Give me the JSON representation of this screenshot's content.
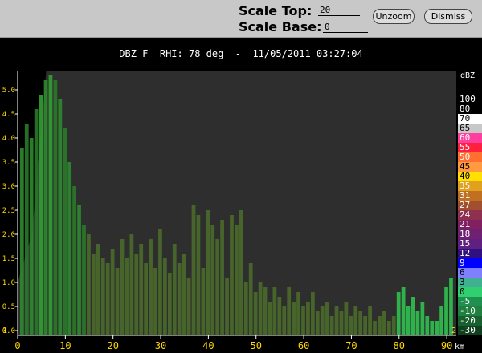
{
  "controls": {
    "scale_top_label": "Scale Top:",
    "scale_top_value": "20",
    "scale_base_label": "Scale Base:",
    "scale_base_value": "0",
    "unzoom_label": "Unzoom",
    "dismiss_label": "Dismiss"
  },
  "display": {
    "title": "DBZ F  RHI: 78 deg  -  11/05/2011 03:27:04",
    "colorbar_unit": "dBZ",
    "x_unit": "km",
    "range_mark_left": "1",
    "range_mark_right": "2"
  },
  "colorbar": {
    "entries": [
      {
        "label": "100",
        "color": "#000000"
      },
      {
        "label": "80",
        "color": "#000000"
      },
      {
        "label": "70",
        "color": "#ffffff"
      },
      {
        "label": "65",
        "color": "#c8c8c8"
      },
      {
        "label": "60",
        "color": "#ff40a0"
      },
      {
        "label": "55",
        "color": "#ff2040"
      },
      {
        "label": "50",
        "color": "#ff7030"
      },
      {
        "label": "45",
        "color": "#ff9a40"
      },
      {
        "label": "40",
        "color": "#ffe000"
      },
      {
        "label": "35",
        "color": "#e0a020"
      },
      {
        "label": "31",
        "color": "#c07020"
      },
      {
        "label": "27",
        "color": "#a05030"
      },
      {
        "label": "24",
        "color": "#903050"
      },
      {
        "label": "21",
        "color": "#802060"
      },
      {
        "label": "18",
        "color": "#702070"
      },
      {
        "label": "15",
        "color": "#602080"
      },
      {
        "label": "12",
        "color": "#301080"
      },
      {
        "label": "9",
        "color": "#0000ff"
      },
      {
        "label": "6",
        "color": "#8080ff"
      },
      {
        "label": "3",
        "color": "#40b090"
      },
      {
        "label": "0",
        "color": "#30d070"
      },
      {
        "label": "-5",
        "color": "#209050"
      },
      {
        "label": "-10",
        "color": "#208040"
      },
      {
        "label": "-20",
        "color": "#186030"
      },
      {
        "label": "-30",
        "color": "#104020"
      }
    ]
  },
  "chart_data": {
    "type": "heatmap",
    "title": "DBZ F  RHI: 78 deg  -  11/05/2011 03:27:04",
    "xlabel": "km",
    "ylabel": "",
    "x_ticks": [
      0,
      10,
      20,
      30,
      40,
      50,
      60,
      70,
      80,
      90
    ],
    "y_ticks": [
      0.0,
      0.5,
      1.0,
      1.5,
      2.0,
      2.5,
      3.0,
      3.5,
      4.0,
      4.5,
      5.0
    ],
    "xlim": [
      0,
      92
    ],
    "ylim": [
      -0.1,
      5.4
    ],
    "columns": [
      {
        "x": 1,
        "top": 3.8,
        "c": "#2d8a2d"
      },
      {
        "x": 2,
        "top": 4.3,
        "c": "#2a7a2a"
      },
      {
        "x": 3,
        "top": 4.0,
        "c": "#2d8a2d"
      },
      {
        "x": 4,
        "top": 4.6,
        "c": "#2a7a2a"
      },
      {
        "x": 5,
        "top": 4.9,
        "c": "#33a033"
      },
      {
        "x": 6,
        "top": 5.2,
        "c": "#2d8a2d"
      },
      {
        "x": 7,
        "top": 5.3,
        "c": "#33a033"
      },
      {
        "x": 8,
        "top": 5.2,
        "c": "#2a7a2a"
      },
      {
        "x": 9,
        "top": 4.8,
        "c": "#2d8a2d"
      },
      {
        "x": 10,
        "top": 4.2,
        "c": "#2a7a2a"
      },
      {
        "x": 11,
        "top": 3.5,
        "c": "#2d8a2d"
      },
      {
        "x": 12,
        "top": 3.0,
        "c": "#2a7a2a"
      },
      {
        "x": 13,
        "top": 2.6,
        "c": "#2d8a2d"
      },
      {
        "x": 14,
        "top": 2.2,
        "c": "#2a7a2a"
      },
      {
        "x": 15,
        "top": 2.0,
        "c": "#4a6a2a"
      },
      {
        "x": 16,
        "top": 1.6,
        "c": "#4a6a2a"
      },
      {
        "x": 17,
        "top": 1.8,
        "c": "#4a6a2a"
      },
      {
        "x": 18,
        "top": 1.5,
        "c": "#4a6a2a"
      },
      {
        "x": 19,
        "top": 1.4,
        "c": "#4a6a2a"
      },
      {
        "x": 20,
        "top": 1.7,
        "c": "#4a6a2a"
      },
      {
        "x": 21,
        "top": 1.3,
        "c": "#4a6a2a"
      },
      {
        "x": 22,
        "top": 1.9,
        "c": "#4a6a2a"
      },
      {
        "x": 23,
        "top": 1.5,
        "c": "#4a6a2a"
      },
      {
        "x": 24,
        "top": 2.0,
        "c": "#4a6a2a"
      },
      {
        "x": 25,
        "top": 1.6,
        "c": "#4a6a2a"
      },
      {
        "x": 26,
        "top": 1.8,
        "c": "#4a6a2a"
      },
      {
        "x": 27,
        "top": 1.4,
        "c": "#4a6a2a"
      },
      {
        "x": 28,
        "top": 1.9,
        "c": "#4a6a2a"
      },
      {
        "x": 29,
        "top": 1.3,
        "c": "#4a6a2a"
      },
      {
        "x": 30,
        "top": 2.1,
        "c": "#4a6a2a"
      },
      {
        "x": 31,
        "top": 1.5,
        "c": "#4a6a2a"
      },
      {
        "x": 32,
        "top": 1.2,
        "c": "#4a6a2a"
      },
      {
        "x": 33,
        "top": 1.8,
        "c": "#4a6a2a"
      },
      {
        "x": 34,
        "top": 1.4,
        "c": "#4a6a2a"
      },
      {
        "x": 35,
        "top": 1.6,
        "c": "#4a6a2a"
      },
      {
        "x": 36,
        "top": 1.1,
        "c": "#4a6a2a"
      },
      {
        "x": 37,
        "top": 2.6,
        "c": "#4a6a2a"
      },
      {
        "x": 38,
        "top": 2.4,
        "c": "#4a6a2a"
      },
      {
        "x": 39,
        "top": 1.3,
        "c": "#4a6a2a"
      },
      {
        "x": 40,
        "top": 2.5,
        "c": "#4a6a2a"
      },
      {
        "x": 41,
        "top": 2.2,
        "c": "#4a6a2a"
      },
      {
        "x": 42,
        "top": 1.9,
        "c": "#4a6a2a"
      },
      {
        "x": 43,
        "top": 2.3,
        "c": "#4a6a2a"
      },
      {
        "x": 44,
        "top": 1.1,
        "c": "#4a6a2a"
      },
      {
        "x": 45,
        "top": 2.4,
        "c": "#4a6a2a"
      },
      {
        "x": 46,
        "top": 2.2,
        "c": "#4a6a2a"
      },
      {
        "x": 47,
        "top": 2.5,
        "c": "#4a6a2a"
      },
      {
        "x": 48,
        "top": 1.0,
        "c": "#4a6a2a"
      },
      {
        "x": 49,
        "top": 1.4,
        "c": "#4a6a2a"
      },
      {
        "x": 50,
        "top": 0.8,
        "c": "#4a6a2a"
      },
      {
        "x": 51,
        "top": 1.0,
        "c": "#4a6a2a"
      },
      {
        "x": 52,
        "top": 0.9,
        "c": "#4a6a2a"
      },
      {
        "x": 53,
        "top": 0.6,
        "c": "#4a6a2a"
      },
      {
        "x": 54,
        "top": 0.9,
        "c": "#4a6a2a"
      },
      {
        "x": 55,
        "top": 0.7,
        "c": "#4a6a2a"
      },
      {
        "x": 56,
        "top": 0.5,
        "c": "#4a6a2a"
      },
      {
        "x": 57,
        "top": 0.9,
        "c": "#4a6a2a"
      },
      {
        "x": 58,
        "top": 0.6,
        "c": "#4a6a2a"
      },
      {
        "x": 59,
        "top": 0.8,
        "c": "#4a6a2a"
      },
      {
        "x": 60,
        "top": 0.5,
        "c": "#4a6a2a"
      },
      {
        "x": 61,
        "top": 0.6,
        "c": "#4a6a2a"
      },
      {
        "x": 62,
        "top": 0.8,
        "c": "#4a6a2a"
      },
      {
        "x": 63,
        "top": 0.4,
        "c": "#4a6a2a"
      },
      {
        "x": 64,
        "top": 0.5,
        "c": "#4a6a2a"
      },
      {
        "x": 65,
        "top": 0.6,
        "c": "#4a6a2a"
      },
      {
        "x": 66,
        "top": 0.3,
        "c": "#4a6a2a"
      },
      {
        "x": 67,
        "top": 0.5,
        "c": "#4a6a2a"
      },
      {
        "x": 68,
        "top": 0.4,
        "c": "#4a6a2a"
      },
      {
        "x": 69,
        "top": 0.6,
        "c": "#4a6a2a"
      },
      {
        "x": 70,
        "top": 0.3,
        "c": "#4a6a2a"
      },
      {
        "x": 71,
        "top": 0.5,
        "c": "#4a6a2a"
      },
      {
        "x": 72,
        "top": 0.4,
        "c": "#4a6a2a"
      },
      {
        "x": 73,
        "top": 0.3,
        "c": "#4a6a2a"
      },
      {
        "x": 74,
        "top": 0.5,
        "c": "#4a6a2a"
      },
      {
        "x": 75,
        "top": 0.2,
        "c": "#4a6a2a"
      },
      {
        "x": 76,
        "top": 0.3,
        "c": "#4a6a2a"
      },
      {
        "x": 77,
        "top": 0.4,
        "c": "#4a6a2a"
      },
      {
        "x": 78,
        "top": 0.2,
        "c": "#4a6a2a"
      },
      {
        "x": 79,
        "top": 0.3,
        "c": "#4a6a2a"
      },
      {
        "x": 80,
        "top": 0.8,
        "c": "#30c050"
      },
      {
        "x": 81,
        "top": 0.9,
        "c": "#30c050"
      },
      {
        "x": 82,
        "top": 0.5,
        "c": "#30c050"
      },
      {
        "x": 83,
        "top": 0.7,
        "c": "#30c050"
      },
      {
        "x": 84,
        "top": 0.4,
        "c": "#30c050"
      },
      {
        "x": 85,
        "top": 0.6,
        "c": "#30c050"
      },
      {
        "x": 86,
        "top": 0.3,
        "c": "#30c050"
      },
      {
        "x": 87,
        "top": 0.2,
        "c": "#30c050"
      },
      {
        "x": 88,
        "top": 0.2,
        "c": "#30c050"
      },
      {
        "x": 89,
        "top": 0.5,
        "c": "#30c050"
      },
      {
        "x": 90,
        "top": 0.9,
        "c": "#30c050"
      },
      {
        "x": 91,
        "top": 1.1,
        "c": "#30c050"
      }
    ],
    "grid": false,
    "legend": "right"
  }
}
